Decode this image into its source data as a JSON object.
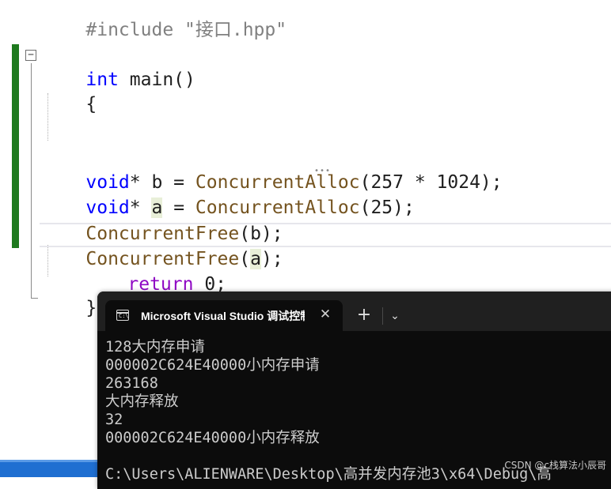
{
  "editor": {
    "include_line": "#include \"接口.hpp\"",
    "lines": {
      "main_kw": "int",
      "main_name": " main()",
      "open_brace": "{",
      "l1_type": "void",
      "l1_rest_a": "* b = ",
      "l1_fn": "ConcurrentAlloc",
      "l1_args": "(257 * 1024);",
      "l2_type": "void",
      "l2_star": "* ",
      "l2_var": "a",
      "l2_eq": " = ",
      "l2_fn": "ConcurrentAlloc",
      "l2_args": "(25);",
      "l3_fn": "ConcurrentFree",
      "l3_args": "(b);",
      "l4_fn": "ConcurrentFree",
      "l4_open": "(",
      "l4_var": "a",
      "l4_close": ");",
      "ret_kw": "return",
      "ret_rest": " 0;",
      "close_brace": "}"
    },
    "collapse_glyph": "−",
    "ellipsis_marker": "•••"
  },
  "terminal": {
    "tab_title": "Microsoft Visual Studio 调试控制台",
    "close_glyph": "✕",
    "new_tab_glyph": "+",
    "dropdown_glyph": "⌄",
    "icon_text": "C:\\",
    "output": [
      "128大内存申请",
      "000002C624E40000小内存申请",
      "263168",
      "大内存释放",
      "32",
      "000002C624E40000小内存释放",
      "",
      "C:\\Users\\ALIENWARE\\Desktop\\高并发内存池3\\x64\\Debug\\高"
    ]
  },
  "watermark": "CSDN @c栈算法小辰哥"
}
